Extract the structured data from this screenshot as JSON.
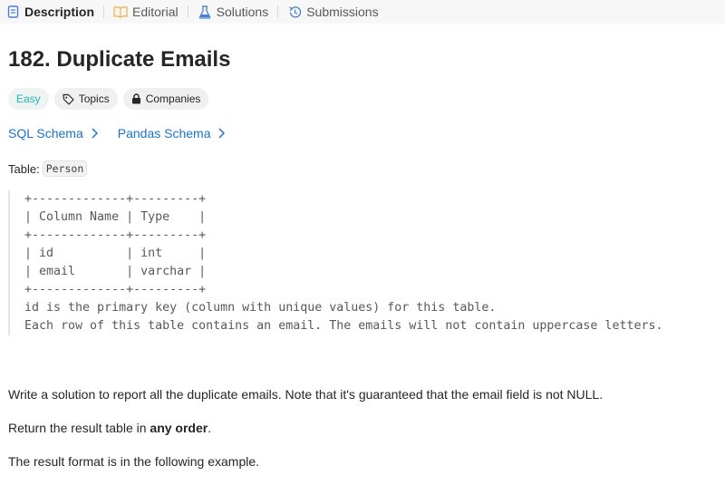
{
  "tabs": [
    {
      "label": "Description",
      "icon": "description-icon",
      "active": true
    },
    {
      "label": "Editorial",
      "icon": "book-icon",
      "active": false
    },
    {
      "label": "Solutions",
      "icon": "flask-icon",
      "active": false
    },
    {
      "label": "Submissions",
      "icon": "history-icon",
      "active": false
    }
  ],
  "problem": {
    "title": "182. Duplicate Emails",
    "difficulty": "Easy",
    "topics_label": "Topics",
    "companies_label": "Companies"
  },
  "schemas": {
    "sql": "SQL Schema",
    "pandas": "Pandas Schema"
  },
  "table": {
    "label": "Table:",
    "name": "Person"
  },
  "schema_block": [
    "+-------------+---------+",
    "| Column Name | Type    |",
    "+-------------+---------+",
    "| id          | int     |",
    "| email       | varchar |",
    "+-------------+---------+",
    "id is the primary key (column with unique values) for this table.",
    "Each row of this table contains an email. The emails will not contain uppercase letters."
  ],
  "description": {
    "p1": "Write a solution to report all the duplicate emails. Note that it's guaranteed that the email field is not NULL.",
    "p2_prefix": "Return the result table in ",
    "p2_bold": "any order",
    "p2_suffix": ".",
    "p3": "The result format is in the following example."
  },
  "colors": {
    "accent": "#1a73c8",
    "easy": "#1cb8b8",
    "text": "#262626"
  }
}
